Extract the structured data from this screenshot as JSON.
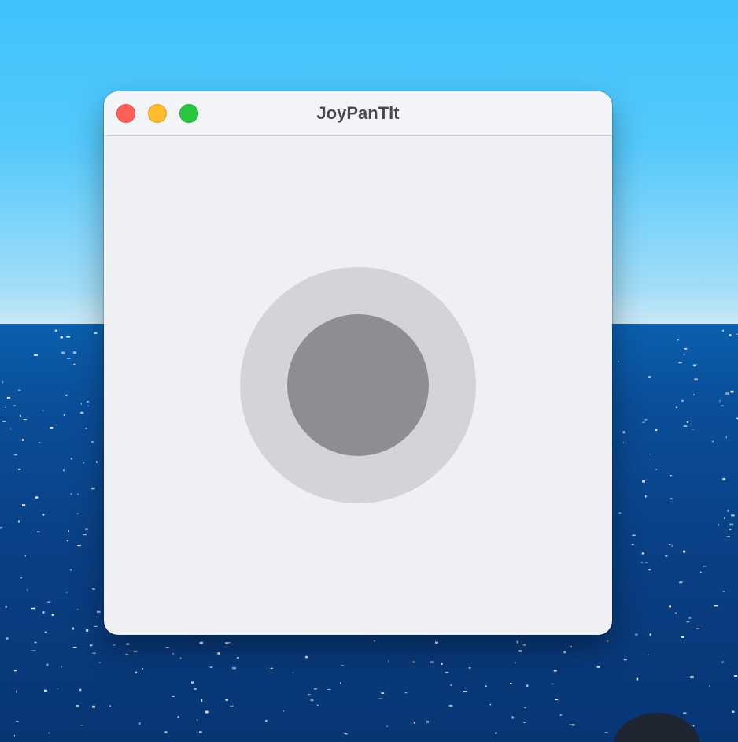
{
  "window": {
    "title": "JoyPanTlt",
    "controls": {
      "close": "close-icon",
      "minimize": "minimize-icon",
      "zoom": "zoom-icon"
    }
  },
  "joystick": {
    "position": {
      "x": 0,
      "y": 0
    }
  },
  "colors": {
    "close": "#fe5f57",
    "minimize": "#febc2e",
    "zoom": "#28c840",
    "window_bg": "#eef0f3",
    "joystick_base": "#d4d4d8",
    "joystick_knob": "#8e8d92"
  }
}
